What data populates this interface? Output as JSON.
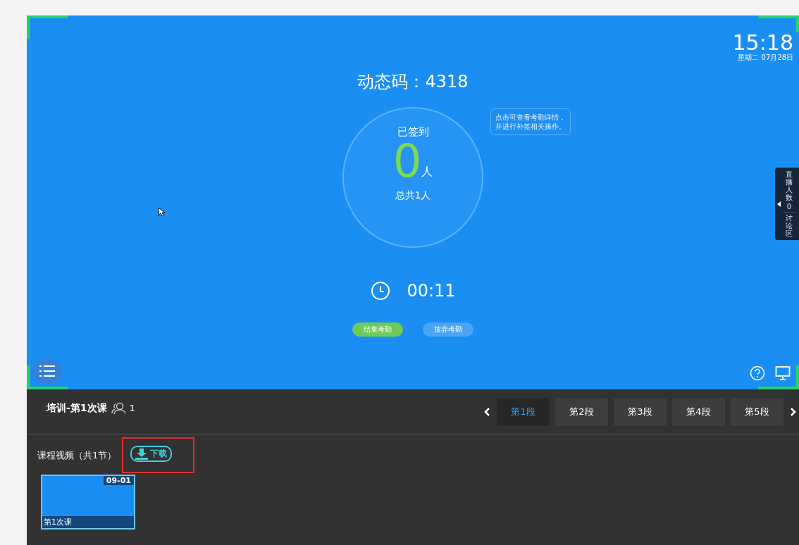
{
  "clock": {
    "time": "15:18",
    "date": "星期二 07月28日"
  },
  "code_title": "动态码：4318",
  "attendance": {
    "label": "已签到",
    "count": "0",
    "unit": "人",
    "total": "总共1人"
  },
  "tooltip": "点击可查看考勤详情，并进行补签相关操作。",
  "timer": "00:11",
  "actions": [
    {
      "label": "结束考勤",
      "kind": "primary"
    },
    {
      "label": "放弃考勤",
      "kind": "secondary"
    }
  ],
  "side_panel": {
    "live_label": "直播人数",
    "live_count": "0",
    "discussion": "讨论区"
  },
  "course": {
    "title": "培训-第1次课",
    "members": "1"
  },
  "segments": [
    {
      "label": "第1段",
      "selected": true
    },
    {
      "label": "第2段",
      "selected": false
    },
    {
      "label": "第3段",
      "selected": false
    },
    {
      "label": "第4段",
      "selected": false
    },
    {
      "label": "第5段",
      "selected": false
    }
  ],
  "videos_heading": "课程视频（共1节）",
  "download": "下载",
  "videos": [
    {
      "date": "09-01",
      "title": "第1次课"
    }
  ]
}
